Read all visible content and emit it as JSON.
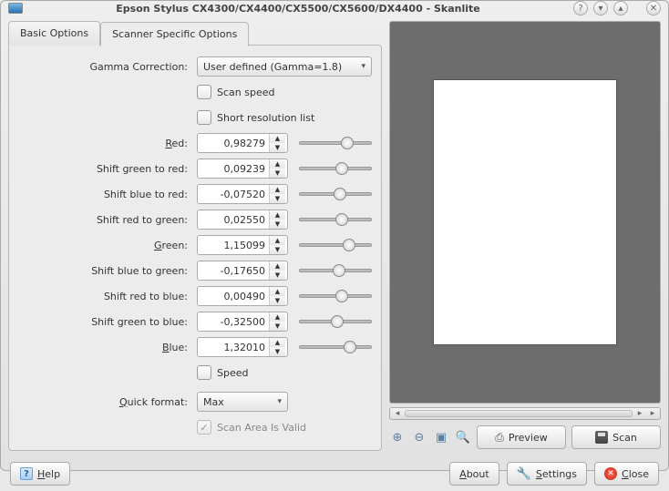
{
  "window": {
    "title": "Epson Stylus CX4300/CX4400/CX5500/CX5600/DX4400 - Skanlite"
  },
  "tabs": {
    "basic": "Basic Options",
    "specific": "Scanner Specific Options"
  },
  "form": {
    "gamma_label": "Gamma Correction:",
    "gamma_value": "User defined (Gamma=1.8)",
    "scan_speed": "Scan speed",
    "short_res": "Short resolution list",
    "speed": "Speed",
    "scan_area_valid": "Scan Area Is Valid",
    "quick_format_label": "Quick format:",
    "quick_format_value": "Max",
    "params": [
      {
        "label": "Red:",
        "u": "R",
        "rest": "ed:",
        "value": "0,98279",
        "pos": 58
      },
      {
        "label": "Shift green to red:",
        "value": "0,09239",
        "pos": 50
      },
      {
        "label": "Shift blue to red:",
        "value": "-0,07520",
        "pos": 48
      },
      {
        "label": "Shift red to green:",
        "value": "0,02550",
        "pos": 50
      },
      {
        "label": "Green:",
        "u": "G",
        "rest": "reen:",
        "value": "1,15099",
        "pos": 60
      },
      {
        "label": "Shift blue to green:",
        "value": "-0,17650",
        "pos": 46
      },
      {
        "label": "Shift red to blue:",
        "value": "0,00490",
        "pos": 50
      },
      {
        "label": "Shift green to blue:",
        "value": "-0,32500",
        "pos": 44
      },
      {
        "label": "Blue:",
        "u": "B",
        "rest": "lue:",
        "value": "1,32010",
        "pos": 62
      }
    ]
  },
  "toolbar": {
    "preview": "Preview",
    "scan": "Scan"
  },
  "footer": {
    "help": "Help",
    "about": "About",
    "settings": "Settings",
    "close": "Close"
  }
}
